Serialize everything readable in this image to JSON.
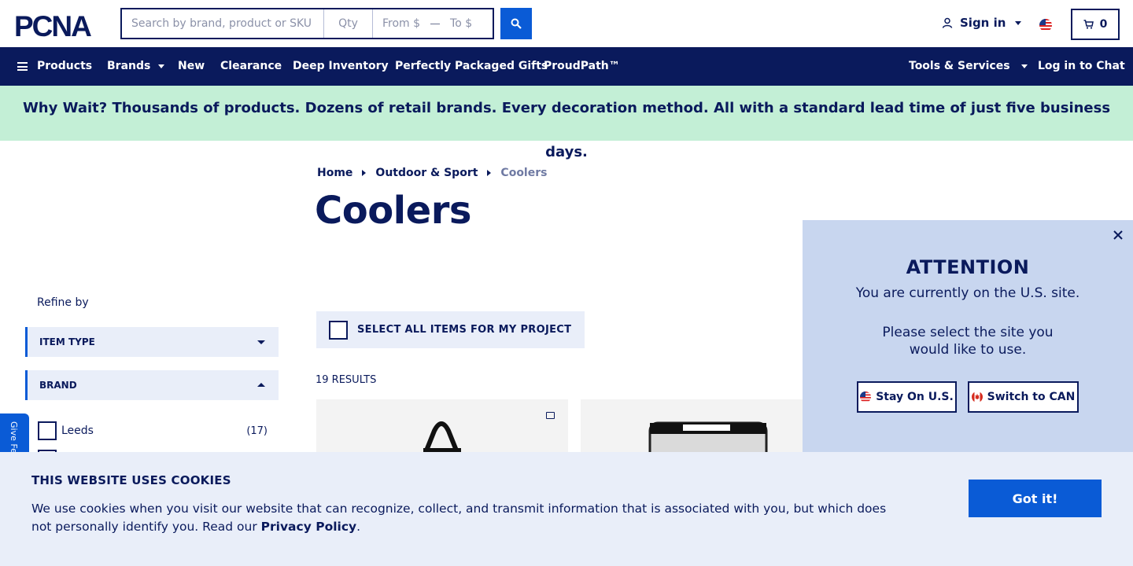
{
  "header": {
    "logo_text": "PCNA",
    "search": {
      "keyword_placeholder": "Search by brand, product or SKU",
      "qty_placeholder": "Qty",
      "from_placeholder": "From $",
      "to_placeholder": "To $"
    },
    "sign_in_label": "Sign in",
    "cart_count": "0"
  },
  "nav": {
    "products": "Products",
    "brands": "Brands",
    "new": "New",
    "clearance": "Clearance",
    "deep_inventory": "Deep Inventory",
    "gifts": "Perfectly Packaged Gifts",
    "proudpath": "ProudPath™",
    "tools": "Tools & Services",
    "chat": "Log in to Chat"
  },
  "promo": {
    "text": "Why Wait? Thousands of products. Dozens of retail brands. Every decoration method. All with a standard lead time of just five business days."
  },
  "breadcrumb": {
    "home": "Home",
    "parent": "Outdoor & Sport",
    "current": "Coolers"
  },
  "page_title": "Coolers",
  "sidebar": {
    "refine_label": "Refine by",
    "facets": [
      {
        "label": "ITEM TYPE",
        "expanded": false
      },
      {
        "label": "BRAND",
        "expanded": true
      }
    ],
    "brand_options": [
      {
        "label": "Leeds",
        "count": "(17)"
      }
    ],
    "feedback_label": "Give Feedback"
  },
  "results": {
    "select_all_label": "SELECT ALL ITEMS FOR MY PROJECT",
    "count_label": "19 RESULTS"
  },
  "attention_modal": {
    "title": "ATTENTION",
    "line1": "You are currently on the U.S. site.",
    "line2": "Please select the site you would like to use.",
    "stay_label": "Stay On U.S.",
    "switch_label": "Switch to CAN"
  },
  "cookie_banner": {
    "title": "THIS WEBSITE USES COOKIES",
    "body": "We use cookies when you visit our website that can recognize, collect, and transmit information that is associated with you, but which does not personally identify you. Read our ",
    "link": "Privacy Policy",
    "suffix": ".",
    "button": "Got it!"
  },
  "colors": {
    "navy": "#0a1a5c",
    "accent_blue": "#0a5bd6",
    "promo_green": "#c3efd6",
    "panel_blue": "#c8d6ef",
    "light_panel": "#e9eef9"
  },
  "icons": [
    "search-icon",
    "user-icon",
    "us-flag-icon",
    "cart-icon",
    "hamburger-icon",
    "close-icon",
    "canada-flag-icon",
    "folder-icon"
  ]
}
